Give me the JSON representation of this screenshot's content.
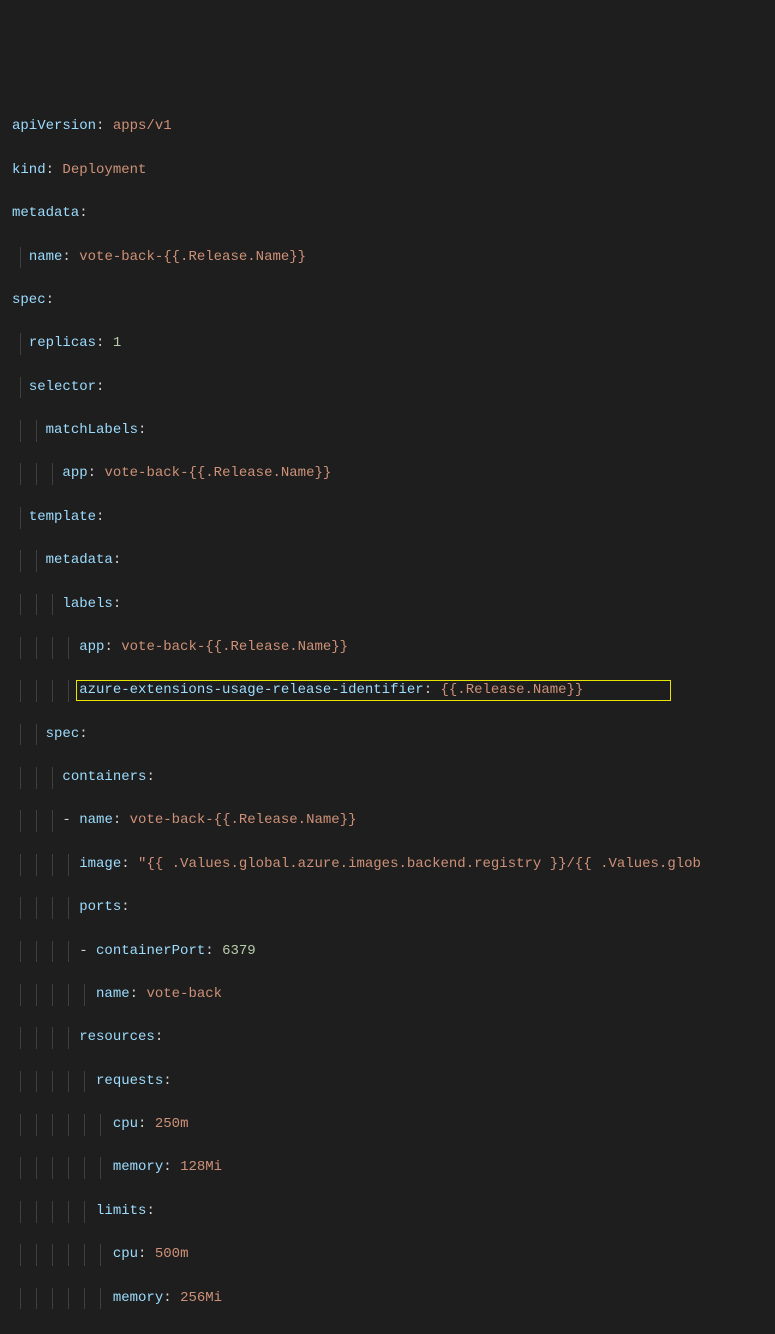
{
  "yaml": {
    "apiVersion_key": "apiVersion",
    "apiVersion_val": "apps/v1",
    "kind_key": "kind",
    "kind_val": "Deployment",
    "metadata_key": "metadata",
    "name_key": "name",
    "name_val": "vote-back-{{.Release.Name}}",
    "spec_key": "spec",
    "replicas_key": "replicas",
    "replicas_val": "1",
    "selector_key": "selector",
    "matchLabels_key": "matchLabels",
    "app_key": "app",
    "app_val": "vote-back-{{.Release.Name}}",
    "template_key": "template",
    "labels_key": "labels",
    "azure_ext_key": "azure-extensions-usage-release-identifier",
    "azure_ext_val": "{{.Release.Name}}",
    "containers_key": "containers",
    "container_name_val": "vote-back-{{.Release.Name}}",
    "image_key": "image",
    "image_val": "\"{{ .Values.global.azure.images.backend.registry }}/{{ .Values.glob",
    "ports_key": "ports",
    "containerPort_key": "containerPort",
    "containerPort_val": "6379",
    "port_name_val": "vote-back",
    "resources_key": "resources",
    "requests_key": "requests",
    "cpu_key": "cpu",
    "cpu_req_val": "250m",
    "memory_key": "memory",
    "memory_req_val": "128Mi",
    "limits_key": "limits",
    "cpu_lim_val": "500m",
    "memory_lim_val": "256Mi"
  },
  "colors": {
    "key": "#9cdcfe",
    "value": "#ce9178",
    "number": "#b5cea8",
    "guide": "#404040",
    "highlight": "#e6e600",
    "bg": "#1e1e1e"
  }
}
